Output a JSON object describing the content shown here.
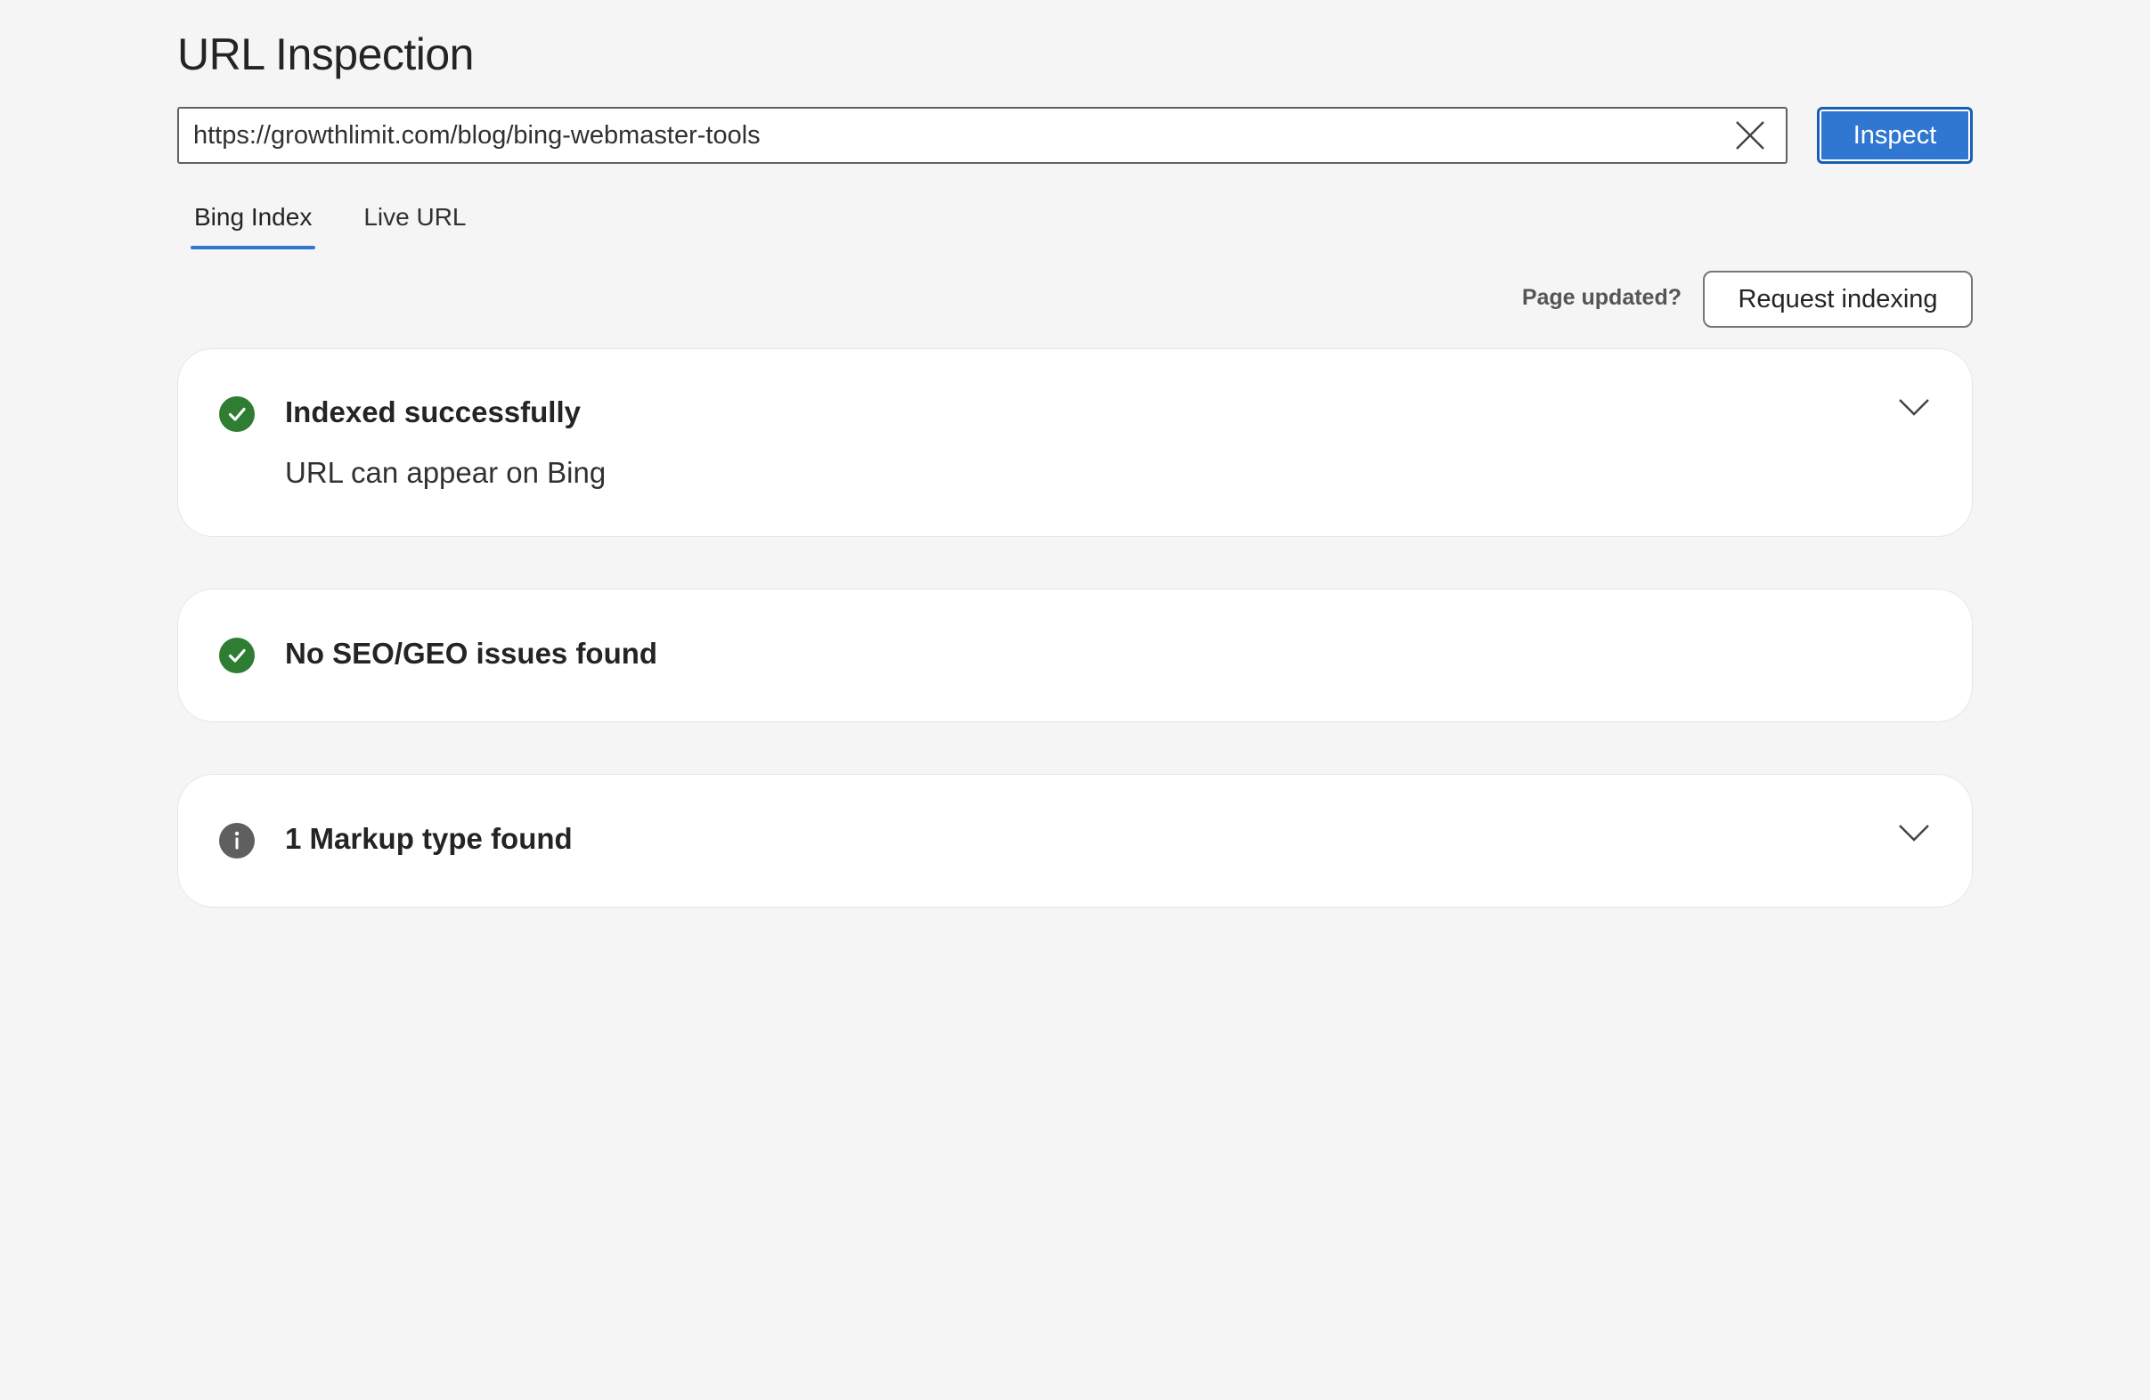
{
  "header": {
    "title": "URL Inspection"
  },
  "search": {
    "value": "https://growthlimit.com/blog/bing-webmaster-tools",
    "inspect_label": "Inspect"
  },
  "tabs": [
    {
      "label": "Bing Index",
      "active": true
    },
    {
      "label": "Live URL",
      "active": false
    }
  ],
  "actions": {
    "page_updated_label": "Page updated?",
    "request_indexing_label": "Request indexing"
  },
  "cards": [
    {
      "heading": "Indexed successfully",
      "subtext": "URL can appear on Bing",
      "icon": "check-circle-icon",
      "expandable": true
    },
    {
      "heading": "No SEO/GEO issues found",
      "icon": "check-circle-icon",
      "expandable": false
    },
    {
      "heading": "1 Markup type found",
      "icon": "info-icon",
      "expandable": true
    }
  ],
  "colors": {
    "accent": "#2f77d0",
    "success": "#2e7d32",
    "info": "#5f5f5f",
    "background": "#f5f5f5"
  }
}
